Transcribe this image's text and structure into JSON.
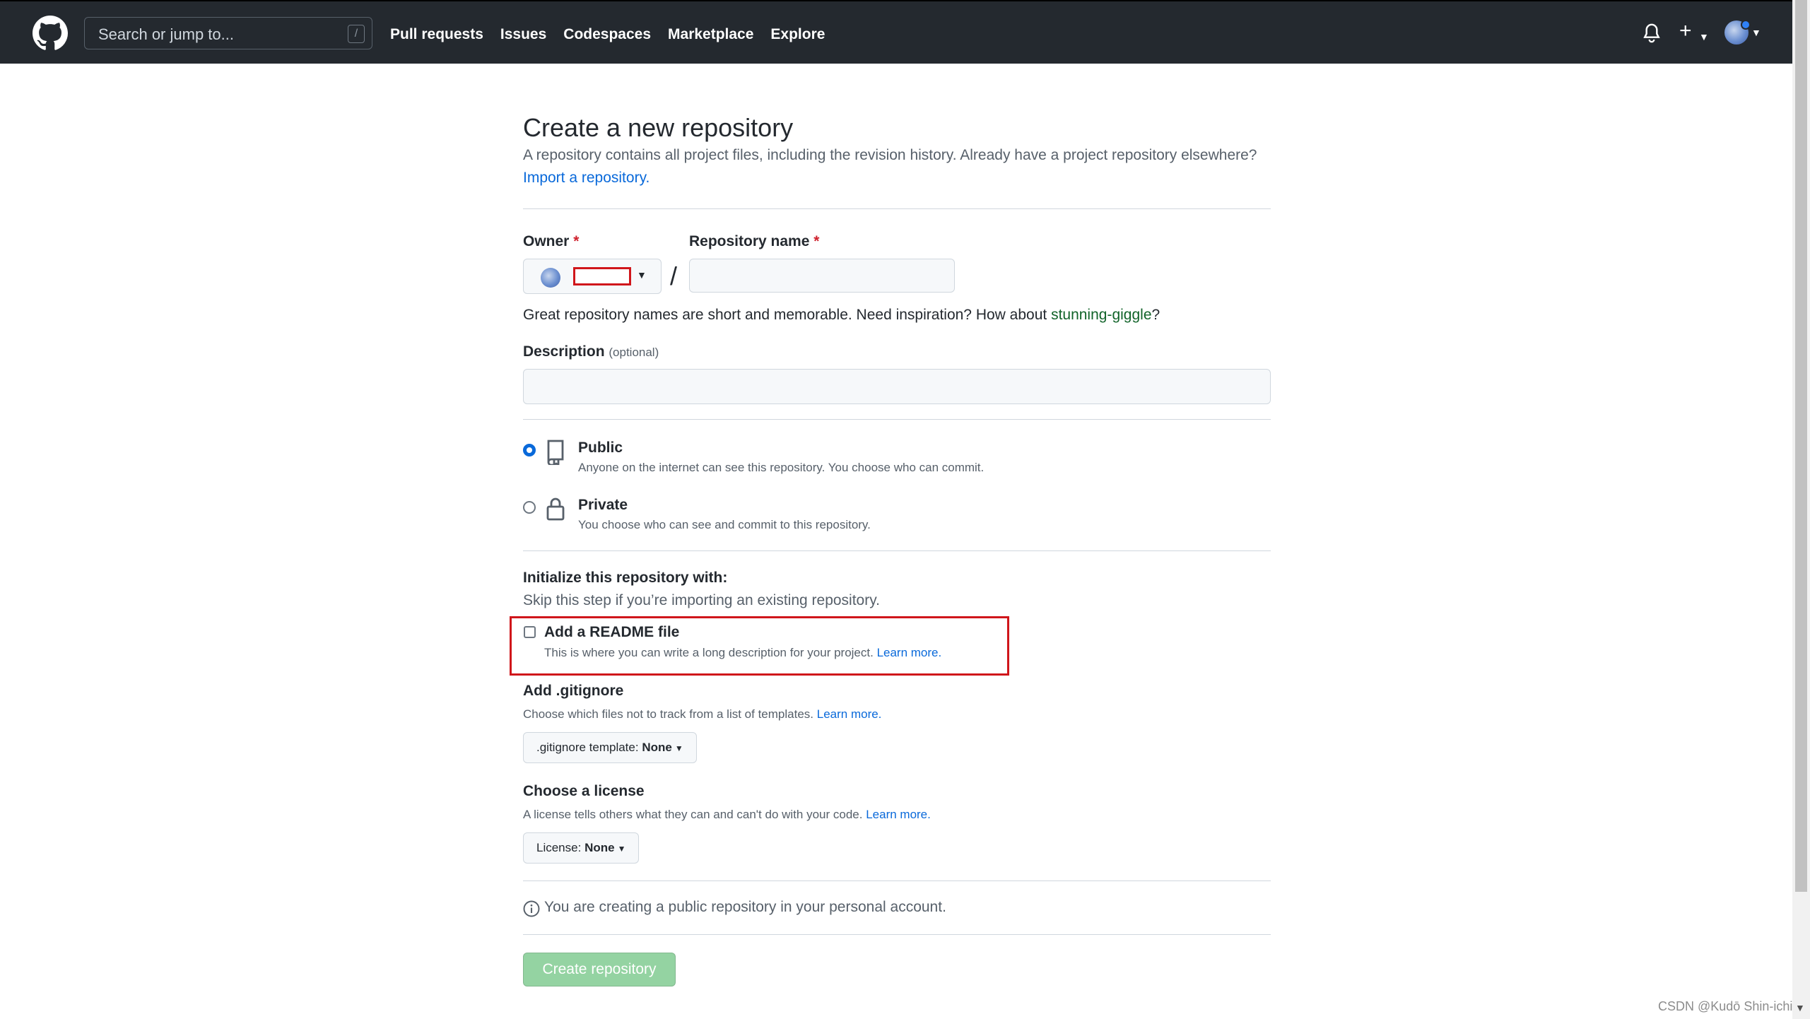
{
  "nav": {
    "search_placeholder": "Search or jump to...",
    "search_shortcut": "/",
    "links": [
      "Pull requests",
      "Issues",
      "Codespaces",
      "Marketplace",
      "Explore"
    ],
    "plus_label": "+"
  },
  "page": {
    "title": "Create a new repository",
    "subtitle": "A repository contains all project files, including the revision history. Already have a project repository elsewhere?",
    "import_link": "Import a repository."
  },
  "form": {
    "owner_label": "Owner",
    "repo_name_label": "Repository name",
    "required_mark": "*",
    "separator": "/",
    "name_hint_prefix": "Great repository names are short and memorable. Need inspiration? How about",
    "name_suggestion": "stunning-giggle",
    "name_hint_suffix": "?",
    "description_label": "Description",
    "description_optional": "(optional)"
  },
  "visibility": {
    "selected": "public",
    "public_title": "Public",
    "public_desc": "Anyone on the internet can see this repository. You choose who can commit.",
    "private_title": "Private",
    "private_desc": "You choose who can see and commit to this repository."
  },
  "init": {
    "title": "Initialize this repository with:",
    "subtitle": "Skip this step if you’re importing an existing repository.",
    "readme_title": "Add a README file",
    "readme_desc": "This is where you can write a long description for your project.",
    "readme_checked": false,
    "learn_more": "Learn more."
  },
  "gitignore": {
    "title": "Add .gitignore",
    "desc": "Choose which files not to track from a list of templates.",
    "learn_more": "Learn more.",
    "button_prefix": ".gitignore template:",
    "button_value": "None"
  },
  "license": {
    "title": "Choose a license",
    "desc": "A license tells others what they can and can't do with your code.",
    "learn_more": "Learn more.",
    "button_prefix": "License:",
    "button_value": "None"
  },
  "footer": {
    "info": "You are creating a public repository in your personal account.",
    "create_button": "Create repository",
    "watermark": "CSDN @Kudō Shin-ichi"
  },
  "colors": {
    "header_bg": "#24292f",
    "link": "#0969da",
    "suggestion": "#116329",
    "required": "#cf222e",
    "create_button_disabled": "#94d3a2",
    "annotation_box": "#d0161b"
  }
}
